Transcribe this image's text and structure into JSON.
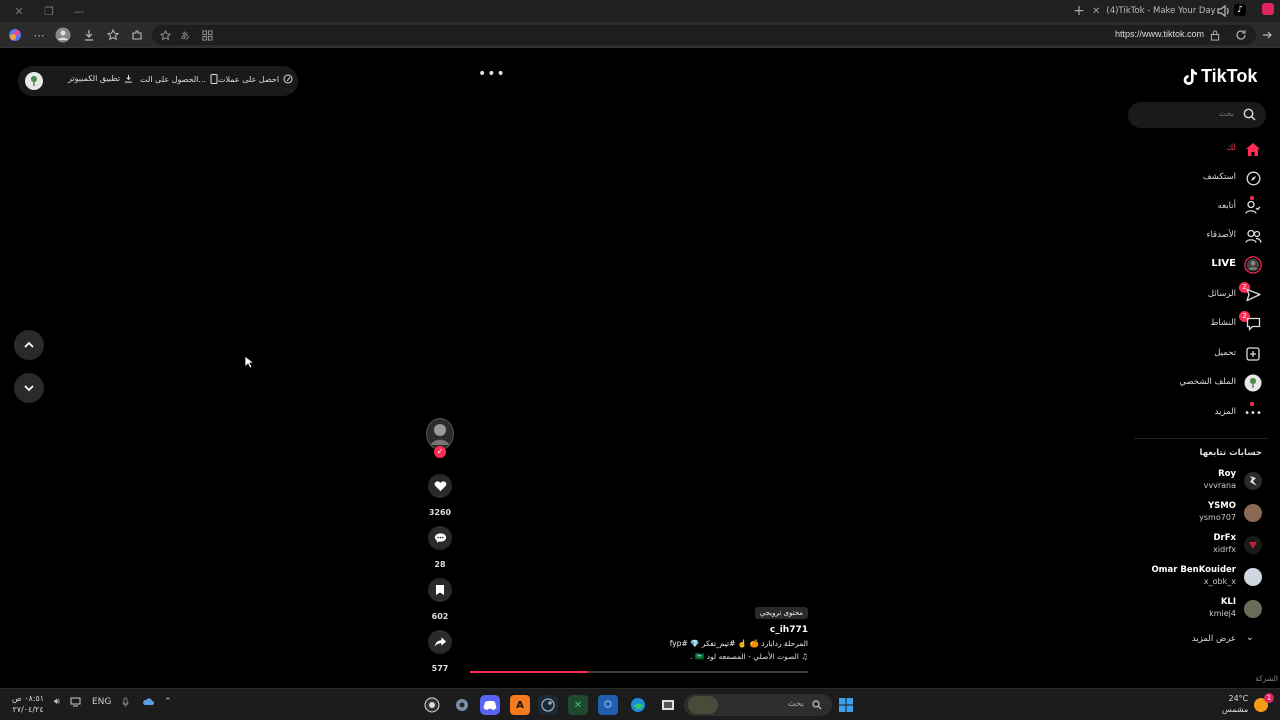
{
  "browser": {
    "tab_title": "(4)TikTok - Make Your Day",
    "url": "https://www.tiktok.com"
  },
  "topbar": {
    "item_1": "احصل على عملات",
    "item_2": "الحصول على الت...",
    "item_3": "تطبيق الكمبيوتر"
  },
  "video": {
    "likes": "3260",
    "comments": "28",
    "saves": "602",
    "shares": "577",
    "tag": "محتوى ترويجي",
    "username": "c_ih771",
    "description": "المرحلة ردابارد 🍊 ☝️ #تيم_تفكر 💎 #fyp",
    "music": "♫ الصوت الأصلي - المصمعه لود 🇸🇦 .",
    "progress": 0.35
  },
  "sidebar": {
    "logo": "TikTok",
    "search_placeholder": "بحث",
    "nav": [
      {
        "label": "لك",
        "icon": "home-icon"
      },
      {
        "label": "استكشف",
        "icon": "compass-icon"
      },
      {
        "label": "أتابعه",
        "icon": "following-icon"
      },
      {
        "label": "الأصدقاء",
        "icon": "friends-icon"
      },
      {
        "label": "LIVE",
        "icon": "live-icon"
      },
      {
        "label": "الرسائل",
        "icon": "messages-icon",
        "badge": "2"
      },
      {
        "label": "النشاط",
        "icon": "activity-icon",
        "badge": "2"
      },
      {
        "label": "تحميل",
        "icon": "upload-icon"
      },
      {
        "label": "الملف الشخصي",
        "icon": "profile-icon"
      },
      {
        "label": "المزيد",
        "icon": "more-icon"
      }
    ],
    "following_title": "حسابات تتابعها",
    "accounts": [
      {
        "name": "Roy",
        "handle": "vvvrana"
      },
      {
        "name": "YSMO",
        "handle": "ysmo707"
      },
      {
        "name": "DrFx",
        "handle": "xidrfx"
      },
      {
        "name": "Omar BenKouider",
        "handle": "x_obk_x"
      },
      {
        "name": "KLI",
        "handle": "kmiej4"
      }
    ],
    "see_more": "عرض المزيد",
    "company": "الشركة"
  },
  "taskbar": {
    "time": "٠٨:٥١ ص",
    "date": "٢٧/٠٤/٢٤",
    "lang": "ENG",
    "search_placeholder": "بحث",
    "temperature": "24°C",
    "weather": "مشمس",
    "notif_count": "1"
  },
  "colors": {
    "accent": "#fe2c55",
    "background": "#000000"
  }
}
